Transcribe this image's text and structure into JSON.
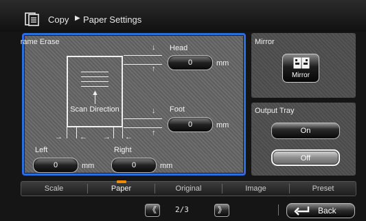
{
  "header": {
    "icon": "copy-document-icon",
    "breadcrumb_copy": "Copy",
    "breadcrumb_arrow": "▶",
    "breadcrumb_page": "Paper Settings"
  },
  "frame_erase": {
    "title": "Frame Erase",
    "head_label": "Head",
    "head_value": "0",
    "head_unit": "mm",
    "foot_label": "Foot",
    "foot_value": "0",
    "foot_unit": "mm",
    "left_label": "Left",
    "left_value": "0",
    "left_unit": "mm",
    "right_label": "Right",
    "right_value": "0",
    "right_unit": "mm",
    "diagram_label": "Scan Direction"
  },
  "mirror": {
    "title": "Mirror",
    "button_label": "Mirror",
    "icon": "mirror-icon"
  },
  "output_tray": {
    "title": "Output Tray",
    "on_label": "On",
    "off_label": "Off",
    "selected": "Off"
  },
  "tabs": [
    {
      "label": "Scale"
    },
    {
      "label": "Paper"
    },
    {
      "label": "Original"
    },
    {
      "label": "Image"
    },
    {
      "label": "Preset"
    }
  ],
  "active_tab": "Paper",
  "footer": {
    "prev_label": "《",
    "page": "2/3",
    "next_label": "》",
    "back_label": "Back",
    "back_icon": "return-arrow-icon"
  },
  "colors": {
    "selection_border": "#2a6ee0",
    "active_tab_indicator": "#f08c00"
  }
}
